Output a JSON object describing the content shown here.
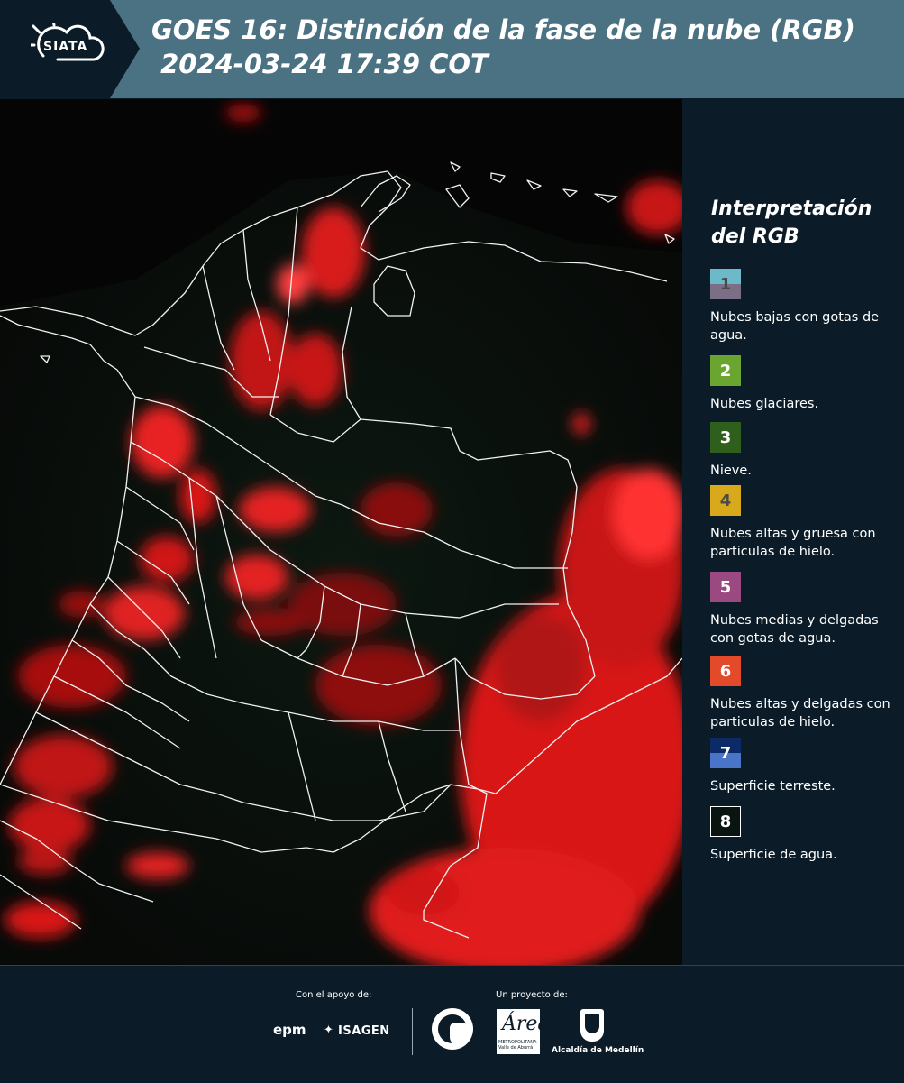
{
  "header": {
    "logo_text": "SIATA",
    "title_line1": "GOES 16: Distinción de la fase de la nube (RGB)",
    "title_line2": " 2024-03-24 17:39 COT"
  },
  "legend": {
    "title": "Interpretación del RGB",
    "items": [
      {
        "number": "1",
        "label": "Nubes bajas con gotas de agua.",
        "color_top": "#6cb9c9",
        "color_bottom": "#7a6f86",
        "number_color": "#4a4a4a"
      },
      {
        "number": "2",
        "label": "Nubes glaciares.",
        "color_top": "#6aa52f",
        "color_bottom": "#6aa52f",
        "number_color": "#ffffff"
      },
      {
        "number": "3",
        "label": "Nieve.",
        "color_top": "#2f5f1d",
        "color_bottom": "#2f5f1d",
        "number_color": "#ffffff"
      },
      {
        "number": "4",
        "label": "Nubes altas y gruesa con particulas de hielo.",
        "color_top": "#d8a91a",
        "color_bottom": "#d8a91a",
        "number_color": "#4a4a4a"
      },
      {
        "number": "5",
        "label": "Nubes medias y delgadas con gotas de agua.",
        "color_top": "#9a4a80",
        "color_bottom": "#9a4a80",
        "number_color": "#ffffff"
      },
      {
        "number": "6",
        "label": "Nubes altas y delgadas con particulas de hielo.",
        "color_top": "#e34a2a",
        "color_bottom": "#e34a2a",
        "number_color": "#ffffff"
      },
      {
        "number": "7",
        "label": "Superficie terreste.",
        "color_top": "#0c2a66",
        "color_bottom": "#4a74c8",
        "number_color": "#ffffff"
      },
      {
        "number": "8",
        "label": "Superficie de agua.",
        "color_top": "#0a1410",
        "color_bottom": "#0a1410",
        "number_color": "#ffffff"
      }
    ]
  },
  "footer": {
    "support_label": "Con el apoyo de:",
    "project_label": "Un proyecto de:",
    "epm": "epm",
    "isagen": "ISAGEN",
    "amva_letter": "Área",
    "amva_small": "METROPOLITANA Valle de Aburrá",
    "medellin": "Alcaldía de Medellín"
  }
}
